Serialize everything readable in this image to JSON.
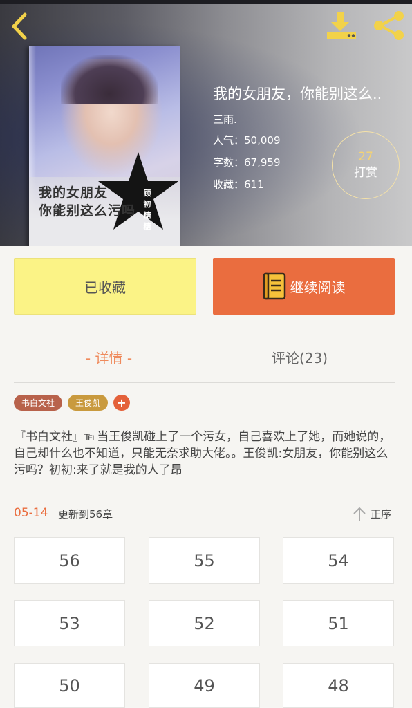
{
  "header": {
    "back_icon": "chevron-left-icon",
    "download_icon": "download-icon",
    "share_icon": "share-icon"
  },
  "cover": {
    "title_line1": "我的女朋友",
    "title_line2": "你能别这么污吗",
    "author_mark": "顾初糖糖"
  },
  "book": {
    "title": "我的女朋友，你能别这么..",
    "author": "三雨.",
    "popularity": "人气：50,009",
    "word_count": "字数：67,959",
    "favorites": "收藏：611"
  },
  "tip": {
    "count": "27",
    "label": "打赏"
  },
  "actions": {
    "favorite_label": "已收藏",
    "read_label": "继续阅读",
    "favorite_color": "#fbf386",
    "read_color": "#ea6d3f"
  },
  "tabs": [
    {
      "label": "- 详情 -",
      "active": true
    },
    {
      "label": "评论(23)",
      "active": false
    }
  ],
  "tags": [
    {
      "label": "书白文社",
      "color": "#b8624b"
    },
    {
      "label": "王俊凯",
      "color": "#c99a3e"
    },
    {
      "label": "+",
      "color": "#e4613a"
    }
  ],
  "description": "『书白文社』℡当王俊凯碰上了一个污女，自己喜欢上了她，而她说的，自己却什么也不知道，只能无奈求助大佬。。王俊凯:女朋友，你能别这么污吗？初初:来了就是我的人了昂",
  "update": {
    "date": "05-14",
    "text": "更新到56章",
    "sort_label": "正序"
  },
  "chapters": [
    "56",
    "55",
    "54",
    "53",
    "52",
    "51",
    "50",
    "49",
    "48"
  ]
}
